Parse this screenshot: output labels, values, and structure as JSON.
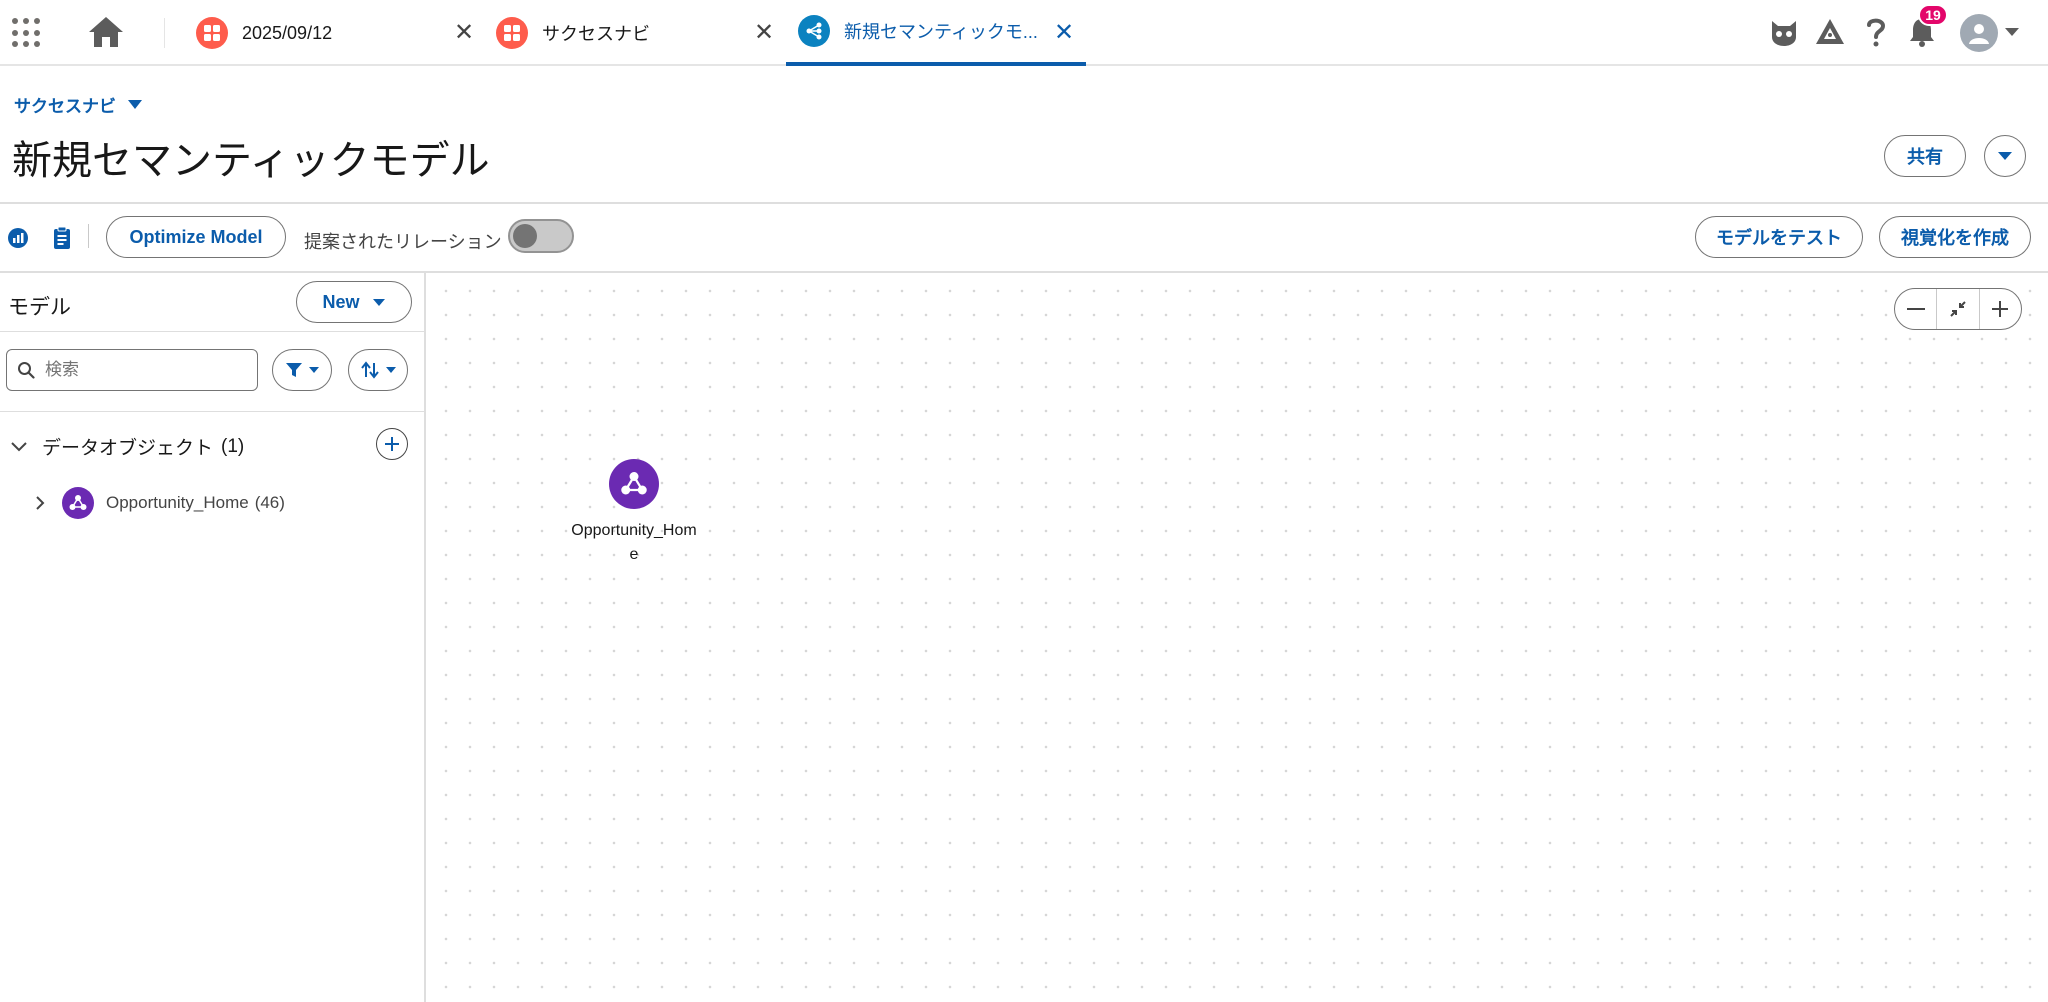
{
  "tabs": [
    {
      "label": "2025/09/12",
      "icon": "dashboard-icon",
      "active": false
    },
    {
      "label": "サクセスナビ",
      "icon": "dashboard-icon",
      "active": false
    },
    {
      "label": "新規セマンティックモ...",
      "icon": "semantic-model-icon",
      "active": true
    }
  ],
  "utility": {
    "notification_count": "19"
  },
  "header": {
    "breadcrumb": "サクセスナビ",
    "title": "新規セマンティックモデル",
    "share_label": "共有"
  },
  "toolbar": {
    "optimize_label": "Optimize Model",
    "suggested_relations_label": "提案されたリレーション",
    "test_model_label": "モデルをテスト",
    "create_viz_label": "視覚化を作成"
  },
  "left_panel": {
    "title": "モデル",
    "new_label": "New",
    "search_placeholder": "検索",
    "section_label": "データオブジェクト",
    "section_count": "(1)",
    "items": [
      {
        "name": "Opportunity_Home",
        "count": "(46)"
      }
    ]
  },
  "canvas": {
    "node_label": "Opportunity_Home"
  },
  "colors": {
    "brand_blue": "#0b5cab",
    "tab_orange": "#fe5c4c",
    "object_purple": "#6b2ab2",
    "badge_pink": "#e3066a"
  }
}
